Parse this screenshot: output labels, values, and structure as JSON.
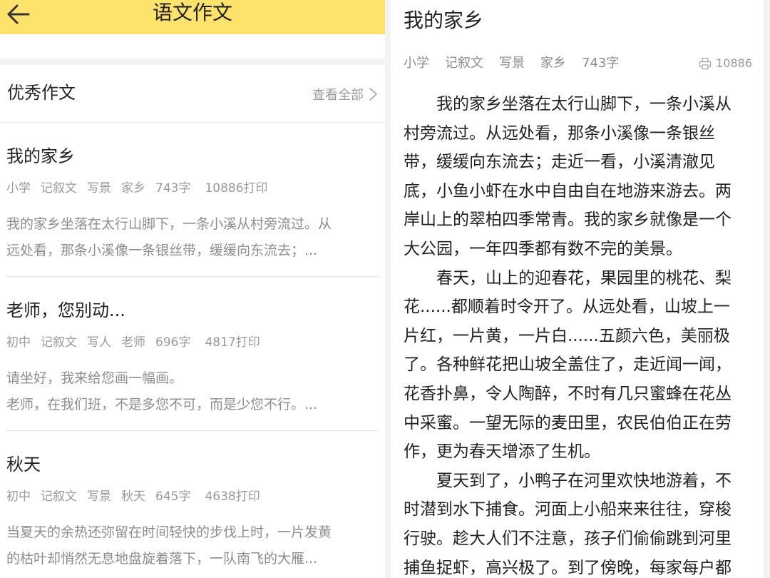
{
  "header": {
    "title": "语文作文"
  },
  "section": {
    "title": "优秀作文",
    "view_all_label": "查看全部"
  },
  "essays": [
    {
      "title": "我的家乡",
      "level": "小学",
      "genre": "记叙文",
      "style": "写景",
      "topic": "家乡",
      "words": "743字",
      "prints": "10886打印",
      "excerpt": [
        "我的家乡坐落在太行山脚下，一条小溪从村旁流过。从",
        "远处看，那条小溪像一条银丝带，缓缓向东流去；..."
      ]
    },
    {
      "title": "老师，您别动...",
      "level": "初中",
      "genre": "记叙文",
      "style": "写人",
      "topic": "老师",
      "words": "696字",
      "prints": "4817打印",
      "excerpt": [
        "请坐好，我来给您画一幅画。",
        "老师，在我们班，不是多您不可，而是少您不行。..."
      ]
    },
    {
      "title": "秋天",
      "level": "初中",
      "genre": "记叙文",
      "style": "写景",
      "topic": "秋天",
      "words": "645字",
      "prints": "4638打印",
      "excerpt": [
        "当夏天的余热还弥留在时间轻快的步伐上时，一片发黄",
        "的枯叶却悄然无息地盘旋着落下，一队南飞的大雁..."
      ]
    }
  ],
  "article": {
    "title": "我的家乡",
    "tags": [
      "小学",
      "记叙文",
      "写景",
      "家乡",
      "743字"
    ],
    "print_count": "10886",
    "lines": [
      "我的家乡坐落在太行山脚下，一条小溪从",
      "村旁流过。从远处看，那条小溪像一条银丝",
      "带，缓缓向东流去；走近一看，小溪清澈见",
      "底，小鱼小虾在水中自由自在地游来游去。两",
      "岸山上的翠柏四季常青。我的家乡就像是一个",
      "大公园，一年四季都有数不完的美景。",
      "春天，山上的迎春花，果园里的桃花、梨",
      "花......都顺着时令开了。从远处看，山坡上一",
      "片红，一片黄，一片白......五颜六色，美丽极",
      "了。各种鲜花把山坡全盖住了，走近闻一闻，",
      "花香扑鼻，令人陶醉，不时有几只蜜蜂在花丛",
      "中采蜜。一望无际的麦田里，农民伯伯正在劳",
      "作，更为春天增添了生机。",
      "夏天到了，小鸭子在河里欢快地游着，不",
      "时潜到水下捕食。河面上小船来来往往，穿梭",
      "行驶。趁大人们不注意，孩子们偷偷跳到河里",
      "捕鱼捉虾，高兴极了。到了傍晚，每家每户都"
    ]
  }
}
